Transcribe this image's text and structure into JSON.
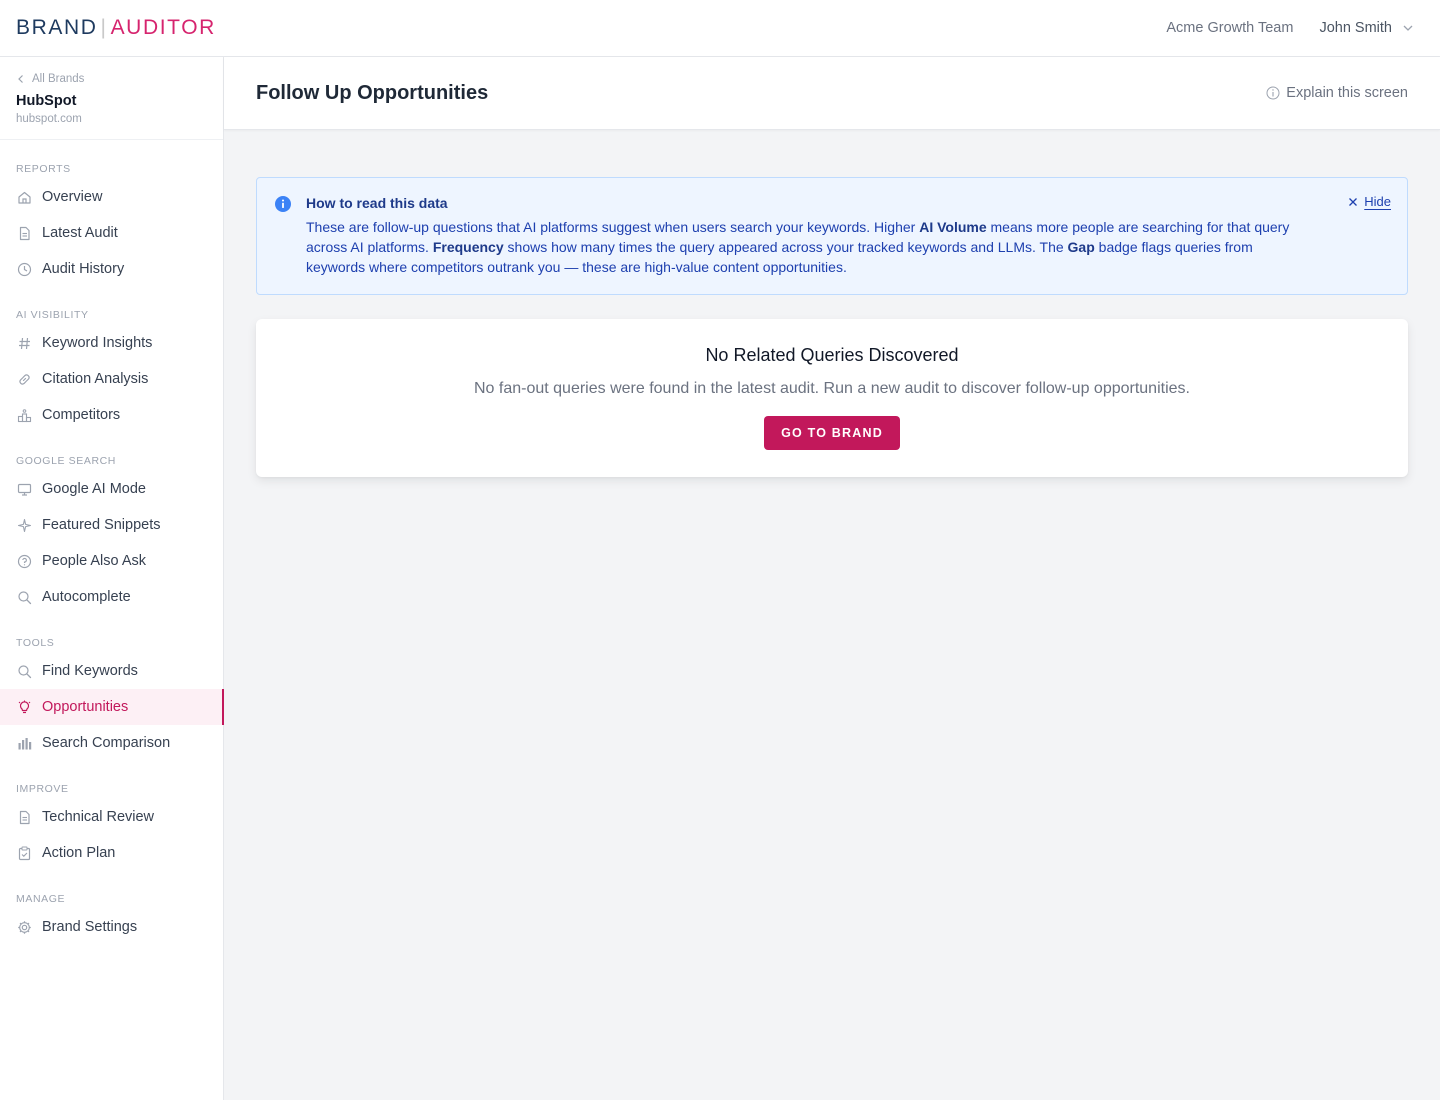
{
  "header": {
    "logo_brand": "BRAND",
    "logo_sep": "|",
    "logo_auditor": "AUDITOR",
    "team": "Acme Growth Team",
    "user": "John Smith"
  },
  "sidebar": {
    "back_label": "All Brands",
    "brand_name": "HubSpot",
    "brand_url": "hubspot.com",
    "sections": [
      {
        "title": "REPORTS",
        "items": [
          {
            "label": "Overview",
            "icon": "home-icon"
          },
          {
            "label": "Latest Audit",
            "icon": "document-icon"
          },
          {
            "label": "Audit History",
            "icon": "clock-icon"
          }
        ]
      },
      {
        "title": "AI VISIBILITY",
        "items": [
          {
            "label": "Keyword Insights",
            "icon": "hash-icon"
          },
          {
            "label": "Citation Analysis",
            "icon": "link-icon"
          },
          {
            "label": "Competitors",
            "icon": "podium-icon"
          }
        ]
      },
      {
        "title": "GOOGLE SEARCH",
        "items": [
          {
            "label": "Google AI Mode",
            "icon": "monitor-icon"
          },
          {
            "label": "Featured Snippets",
            "icon": "sparkle-icon"
          },
          {
            "label": "People Also Ask",
            "icon": "question-icon"
          },
          {
            "label": "Autocomplete",
            "icon": "search-icon"
          }
        ]
      },
      {
        "title": "TOOLS",
        "items": [
          {
            "label": "Find Keywords",
            "icon": "search-icon"
          },
          {
            "label": "Opportunities",
            "icon": "lightbulb-icon",
            "active": true
          },
          {
            "label": "Search Comparison",
            "icon": "bar-chart-icon"
          }
        ]
      },
      {
        "title": "IMPROVE",
        "items": [
          {
            "label": "Technical Review",
            "icon": "document-icon"
          },
          {
            "label": "Action Plan",
            "icon": "clipboard-icon"
          }
        ]
      },
      {
        "title": "MANAGE",
        "items": [
          {
            "label": "Brand Settings",
            "icon": "gear-icon"
          }
        ]
      }
    ]
  },
  "page": {
    "title": "Follow Up Opportunities",
    "explain": "Explain this screen"
  },
  "info": {
    "title": "How to read this data",
    "text_1": "These are follow-up questions that AI platforms suggest when users search your keywords. Higher ",
    "bold_1": "AI Volume",
    "text_2": " means more people are searching for that query across AI platforms. ",
    "bold_2": "Frequency",
    "text_3": " shows how many times the query appeared across your tracked keywords and LLMs. The ",
    "bold_3": "Gap",
    "text_4": " badge flags queries from keywords where competitors outrank you — these are high-value content opportunities.",
    "hide_label": "Hide"
  },
  "empty_state": {
    "title": "No Related Queries Discovered",
    "text": "No fan-out queries were found in the latest audit. Run a new audit to discover follow-up opportunities.",
    "button": "GO TO BRAND"
  },
  "colors": {
    "accent": "#c2185b",
    "logo_brand": "#1e3a5f",
    "logo_auditor": "#d6246e",
    "info_bg": "#eef5ff",
    "info_text": "#1e40af"
  }
}
